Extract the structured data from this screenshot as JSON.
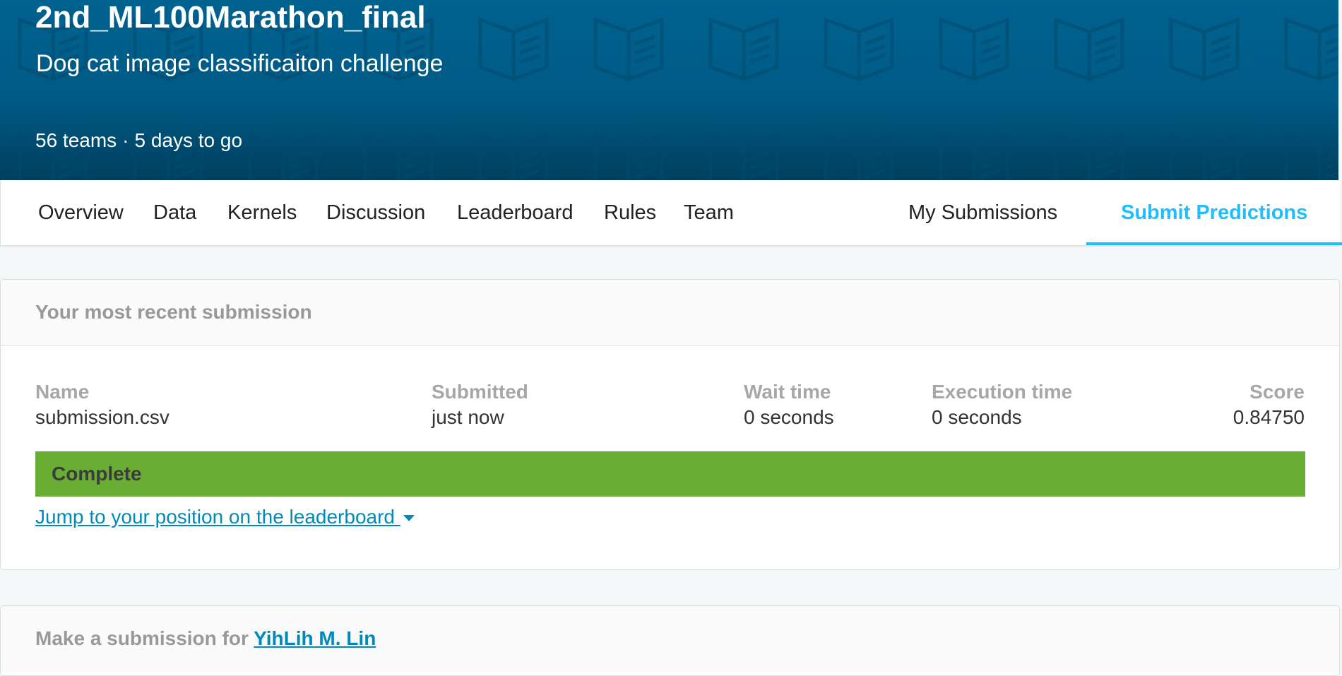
{
  "competition": {
    "title": "2nd_ML100Marathon_final",
    "subtitle": "Dog cat image classificaiton challenge",
    "teams": "56 teams",
    "separator": "·",
    "time_left": "5 days to go"
  },
  "nav": {
    "tabs": [
      {
        "label": "Overview"
      },
      {
        "label": "Data"
      },
      {
        "label": "Kernels"
      },
      {
        "label": "Discussion"
      },
      {
        "label": "Leaderboard"
      },
      {
        "label": "Rules"
      },
      {
        "label": "Team"
      },
      {
        "label": "My Submissions"
      },
      {
        "label": "Submit Predictions"
      }
    ],
    "active_tab": "Submit Predictions"
  },
  "recent_submission": {
    "heading": "Your most recent submission",
    "columns": {
      "name": {
        "label": "Name",
        "value": "submission.csv"
      },
      "submitted": {
        "label": "Submitted",
        "value": "just now"
      },
      "wait_time": {
        "label": "Wait time",
        "value": "0 seconds"
      },
      "execution_time": {
        "label": "Execution time",
        "value": "0 seconds"
      },
      "score": {
        "label": "Score",
        "value": "0.84750"
      }
    },
    "status": "Complete",
    "jump_link": "Jump to your position on the leaderboard "
  },
  "make_submission": {
    "prefix": "Make a submission for ",
    "user": "YihLih M. Lin"
  },
  "colors": {
    "header_bg": "#005a85",
    "accent": "#20beff",
    "status_complete": "#69ad35",
    "link": "#008abc"
  }
}
